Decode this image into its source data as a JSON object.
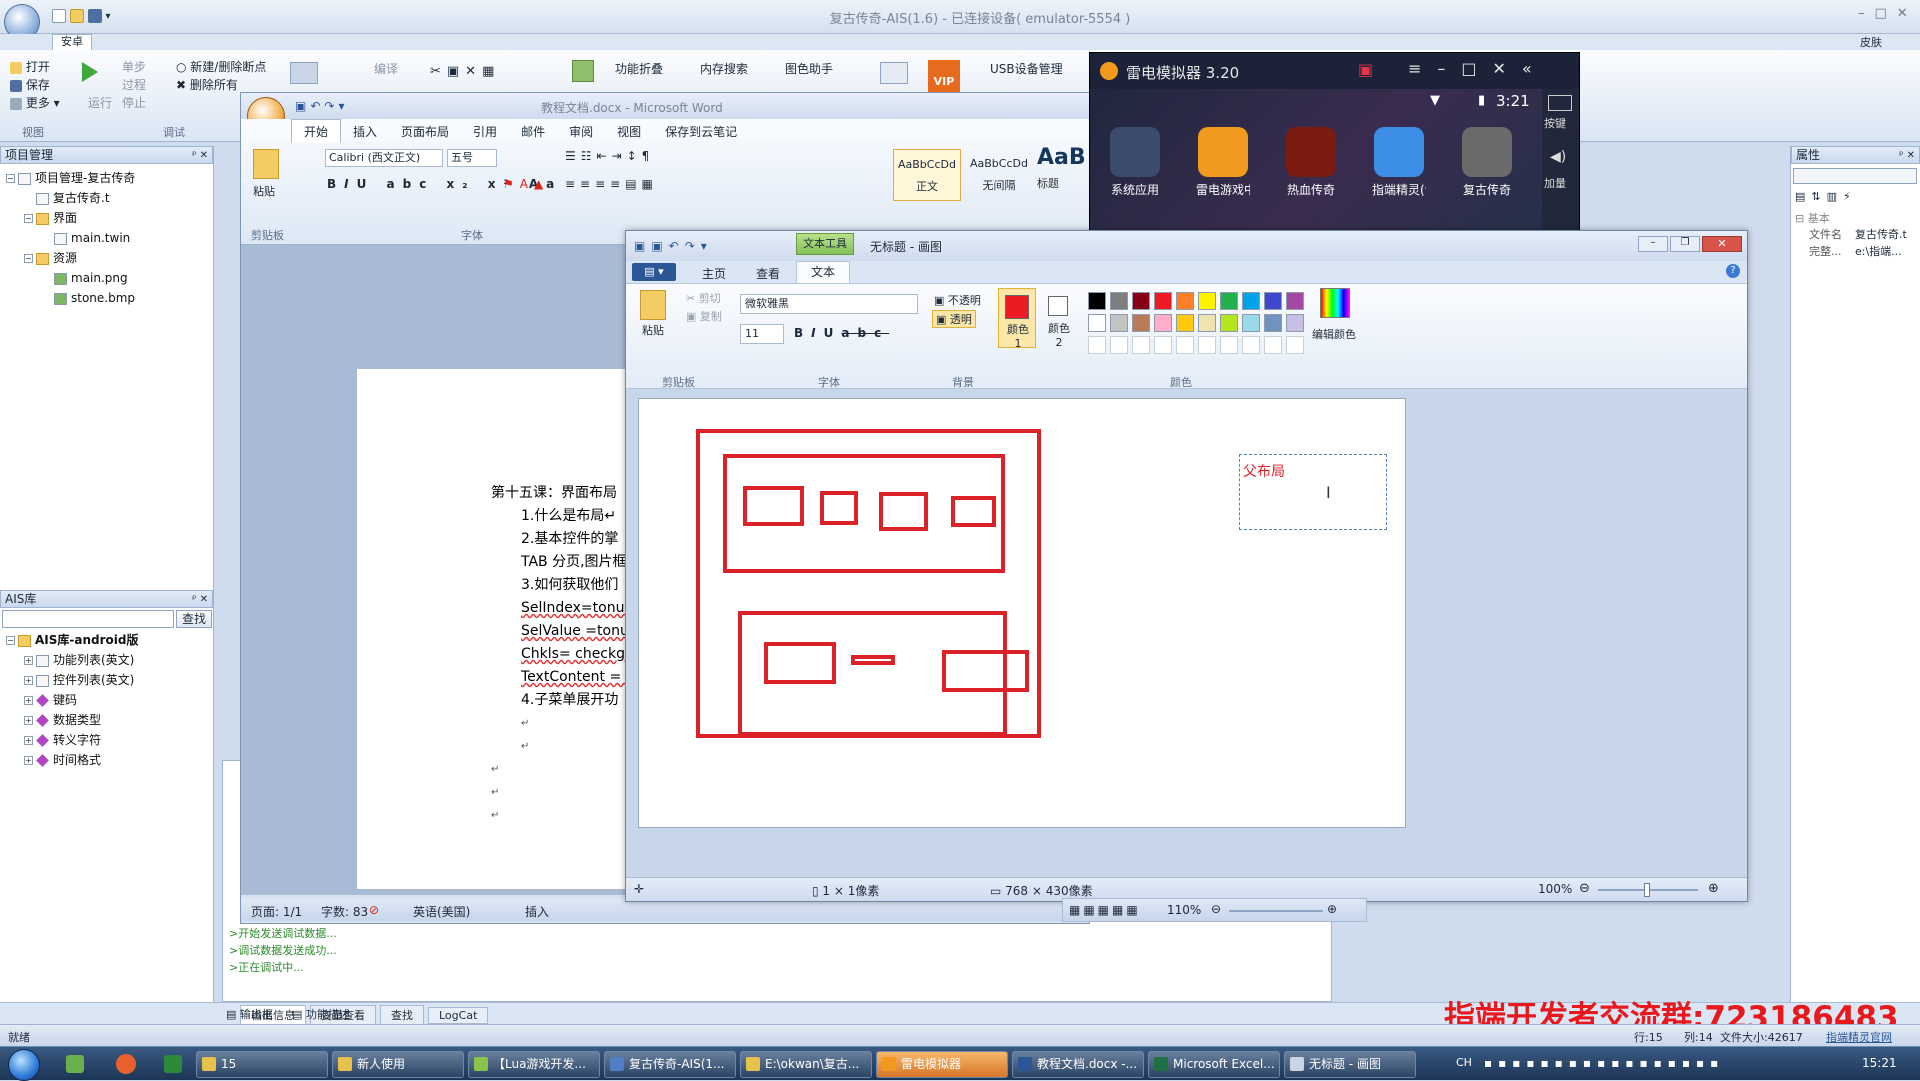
{
  "ide": {
    "title": "复古传奇-AIS(1.6) - 已连接设备( emulator-5554 )",
    "tab_active": "安卓",
    "top_right": "皮肤",
    "ribbon": {
      "file_items": [
        "打开",
        "保存",
        "更多"
      ],
      "file_group": "视图",
      "run_label": "运行",
      "debug_items": [
        "单步",
        "过程",
        "停止"
      ],
      "breakpoint_items": [
        "新建/删除断点",
        "删除所有"
      ],
      "debug_group": "调试",
      "compile_label": "编译",
      "fold_label": "功能折叠",
      "mem_label": "内存搜索",
      "color_label": "图色助手",
      "usb_label": "USB设备管理",
      "vip_label": "VIP"
    },
    "project": {
      "header": "项目管理",
      "nodes": [
        {
          "label": "项目管理-复古传奇",
          "level": 0,
          "type": "project"
        },
        {
          "label": "复古传奇.t",
          "level": 1,
          "type": "file"
        },
        {
          "label": "界面",
          "level": 1,
          "type": "folder"
        },
        {
          "label": "main.twin",
          "level": 2,
          "type": "file"
        },
        {
          "label": "资源",
          "level": 1,
          "type": "folder"
        },
        {
          "label": "main.png",
          "level": 2,
          "type": "image"
        },
        {
          "label": "stone.bmp",
          "level": 2,
          "type": "image"
        }
      ]
    },
    "library": {
      "header": "AIS库",
      "search_button": "查找",
      "search_value": "",
      "nodes": [
        {
          "label": "AIS库-android版",
          "level": 0,
          "type": "folder"
        },
        {
          "label": "功能列表(英文)",
          "level": 1,
          "type": "list"
        },
        {
          "label": "控件列表(英文)",
          "level": 1,
          "type": "list"
        },
        {
          "label": "键码",
          "level": 1,
          "type": "diamond"
        },
        {
          "label": "数据类型",
          "level": 1,
          "type": "diamond"
        },
        {
          "label": "转义字符",
          "level": 1,
          "type": "diamond"
        },
        {
          "label": "时间格式",
          "level": 1,
          "type": "diamond"
        }
      ]
    },
    "output": {
      "lines": [
        ">开始发送调试数据...",
        ">调试数据发送成功...",
        ">正在调试中..."
      ],
      "tabs": [
        "输出信息",
        "变量查看",
        "查找",
        "LogCat"
      ],
      "bottom_tabs": [
        "输出框",
        "功能描述"
      ]
    },
    "properties": {
      "header": "属性",
      "category": "基本",
      "rows": [
        {
          "name": "文件名",
          "value": "复古传奇.t"
        },
        {
          "name": "完整...",
          "value": "e:\\指端..."
        }
      ]
    },
    "status": {
      "left": "就绪",
      "line": "行:15",
      "col": "列:14",
      "size": "文件大小:42617",
      "link": "指端精灵官网"
    }
  },
  "word": {
    "title": "教程文档.docx - Microsoft Word",
    "tabs": [
      "开始",
      "插入",
      "页面布局",
      "引用",
      "邮件",
      "审阅",
      "视图",
      "保存到云笔记"
    ],
    "paste": "粘贴",
    "clipboard_group": "剪贴板",
    "font_group": "字体",
    "font_name": "Calibri (西文正文)",
    "font_size": "五号",
    "styles": [
      {
        "sample": "AaBbCcDd",
        "name": "正文"
      },
      {
        "sample": "AaBbCcDd",
        "name": "无间隔"
      },
      {
        "sample": "AaB",
        "name": "标题"
      }
    ],
    "doc_lines": [
      {
        "text": "第十五课：界面布局",
        "indent": 0,
        "squiggle": false
      },
      {
        "text": "1.什么是布局↵",
        "indent": 1,
        "squiggle": false
      },
      {
        "text": "2.基本控件的掌",
        "indent": 1,
        "squiggle": false
      },
      {
        "text": "TAB 分页,图片框",
        "indent": 1,
        "squiggle": false
      },
      {
        "text": "3.如何获取他们",
        "indent": 1,
        "squiggle": false
      },
      {
        "text": "SelIndex=tonum",
        "indent": 1,
        "squiggle": true
      },
      {
        "text": "SelValue =tonum",
        "indent": 1,
        "squiggle": true
      },
      {
        "text": "Chkls= checkgets",
        "indent": 1,
        "squiggle": true
      },
      {
        "text": "TextContent = to",
        "indent": 1,
        "squiggle": true
      },
      {
        "text": "4.子菜单展开功",
        "indent": 1,
        "squiggle": false
      },
      {
        "text": "↵",
        "indent": 1,
        "squiggle": false
      },
      {
        "text": "↵",
        "indent": 1,
        "squiggle": false
      },
      {
        "text": "↵",
        "indent": 0,
        "squiggle": false
      },
      {
        "text": "↵",
        "indent": 0,
        "squiggle": false
      },
      {
        "text": "↵",
        "indent": 0,
        "squiggle": false
      }
    ],
    "status": {
      "page": "页面: 1/1",
      "words": "字数: 83",
      "lang": "英语(美国)",
      "mode": "插入",
      "zoom": "110%"
    }
  },
  "emulator": {
    "title": "雷电模拟器 3.20",
    "time": "3:21",
    "apps": [
      {
        "label": "系统应用",
        "color": "#3b4c6e"
      },
      {
        "label": "雷电游戏中心",
        "color": "#f29a1e"
      },
      {
        "label": "热血传奇",
        "color": "#7a1c12"
      },
      {
        "label": "指端精灵(调...",
        "color": "#3d8ee6"
      },
      {
        "label": "复古传奇",
        "color": "#6a6a6a"
      }
    ],
    "side_buttons": [
      "按键",
      "加量"
    ]
  },
  "paint": {
    "title": "无标题 - 画图",
    "context_tab": "文本工具",
    "tabs": [
      "主页",
      "查看",
      "文本"
    ],
    "paste": "粘贴",
    "cut": "剪切",
    "copy": "复制",
    "clipboard_group": "剪贴板",
    "font_name": "微软雅黑",
    "font_size": "11",
    "font_group": "字体",
    "opaque": "不透明",
    "transparent": "透明",
    "background_group": "背景",
    "color1_label": "颜色 1",
    "color2_label": "颜色 2",
    "edit_colors": "编辑颜色",
    "colors_group": "颜色",
    "palette": [
      "#000000",
      "#7f7f7f",
      "#880015",
      "#ed1c24",
      "#ff7f27",
      "#fff200",
      "#22b14c",
      "#00a2e8",
      "#3f48cc",
      "#a349a4",
      "#ffffff",
      "#c3c3c3",
      "#b97a57",
      "#ffaec9",
      "#ffc90e",
      "#efe4b0",
      "#b5e61d",
      "#99d9ea",
      "#7092be",
      "#c8bfe7"
    ],
    "color1": "#ed1c24",
    "color2": "#ffffff",
    "textbox_text": "父布局",
    "status": {
      "cursor": "1 × 1像素",
      "size": "768 × 430像素",
      "zoom": "100%"
    }
  },
  "taskbar": {
    "items": [
      {
        "label": "15",
        "color": "#e8c14a"
      },
      {
        "label": "新人使用",
        "color": "#e8c14a"
      },
      {
        "label": "【Lua游戏开发...",
        "color": "#8bc34a"
      },
      {
        "label": "复古传奇-AIS(1...",
        "color": "#4f7fc4"
      },
      {
        "label": "E:\\okwan\\复古...",
        "color": "#e8c14a"
      },
      {
        "label": "雷电模拟器",
        "color": "#f29a1e"
      },
      {
        "label": "教程文档.docx -...",
        "color": "#2b5797"
      },
      {
        "label": "Microsoft Excel...",
        "color": "#1e7145"
      },
      {
        "label": "无标题 - 画图",
        "color": "#c9d4e4"
      }
    ],
    "lang": "CH",
    "clock": "15:21"
  },
  "watermark": "指端开发者交流群:723186483"
}
